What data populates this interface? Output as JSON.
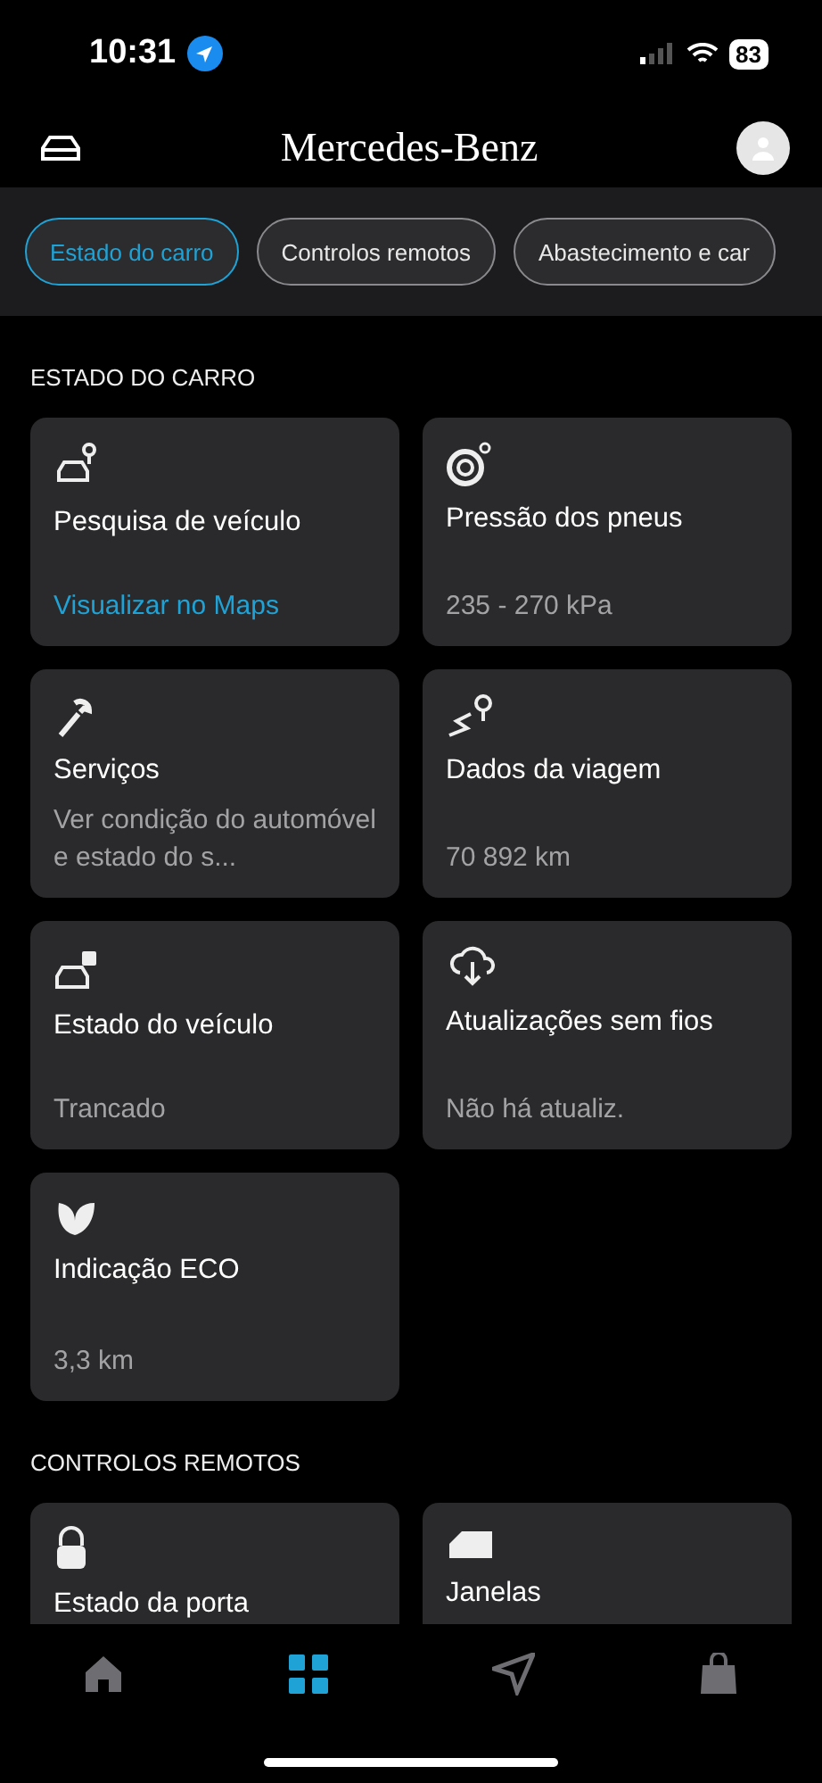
{
  "status_bar": {
    "time": "10:31",
    "battery": "83"
  },
  "header": {
    "title": "Mercedes-Benz"
  },
  "tabs": [
    {
      "label": "Estado do carro",
      "selected": true
    },
    {
      "label": "Controlos remotos",
      "selected": false
    },
    {
      "label": "Abastecimento e car",
      "selected": false
    }
  ],
  "sections": [
    {
      "title": "ESTADO DO CARRO",
      "cards": [
        {
          "title": "Pesquisa de veículo",
          "value": "Visualizar no Maps",
          "link": true
        },
        {
          "title": "Pressão dos pneus",
          "value": "235 - 270 kPa",
          "link": false
        },
        {
          "title": "Serviços",
          "value": "Ver condição do automóvel e estado do s...",
          "link": false
        },
        {
          "title": "Dados da viagem",
          "value": "70 892 km",
          "link": false
        },
        {
          "title": "Estado do veículo",
          "value": "Trancado",
          "link": false
        },
        {
          "title": "Atualizações sem fios",
          "value": "Não há atualiz.",
          "link": false
        },
        {
          "title": "Indicação ECO",
          "value": "3,3 km",
          "link": false
        }
      ]
    },
    {
      "title": "CONTROLOS REMOTOS",
      "cards": [
        {
          "title": "Estado da porta"
        },
        {
          "title": "Janelas"
        }
      ]
    }
  ],
  "bottom_nav": [
    {
      "selected": false
    },
    {
      "selected": true
    },
    {
      "selected": false
    },
    {
      "selected": false
    }
  ]
}
